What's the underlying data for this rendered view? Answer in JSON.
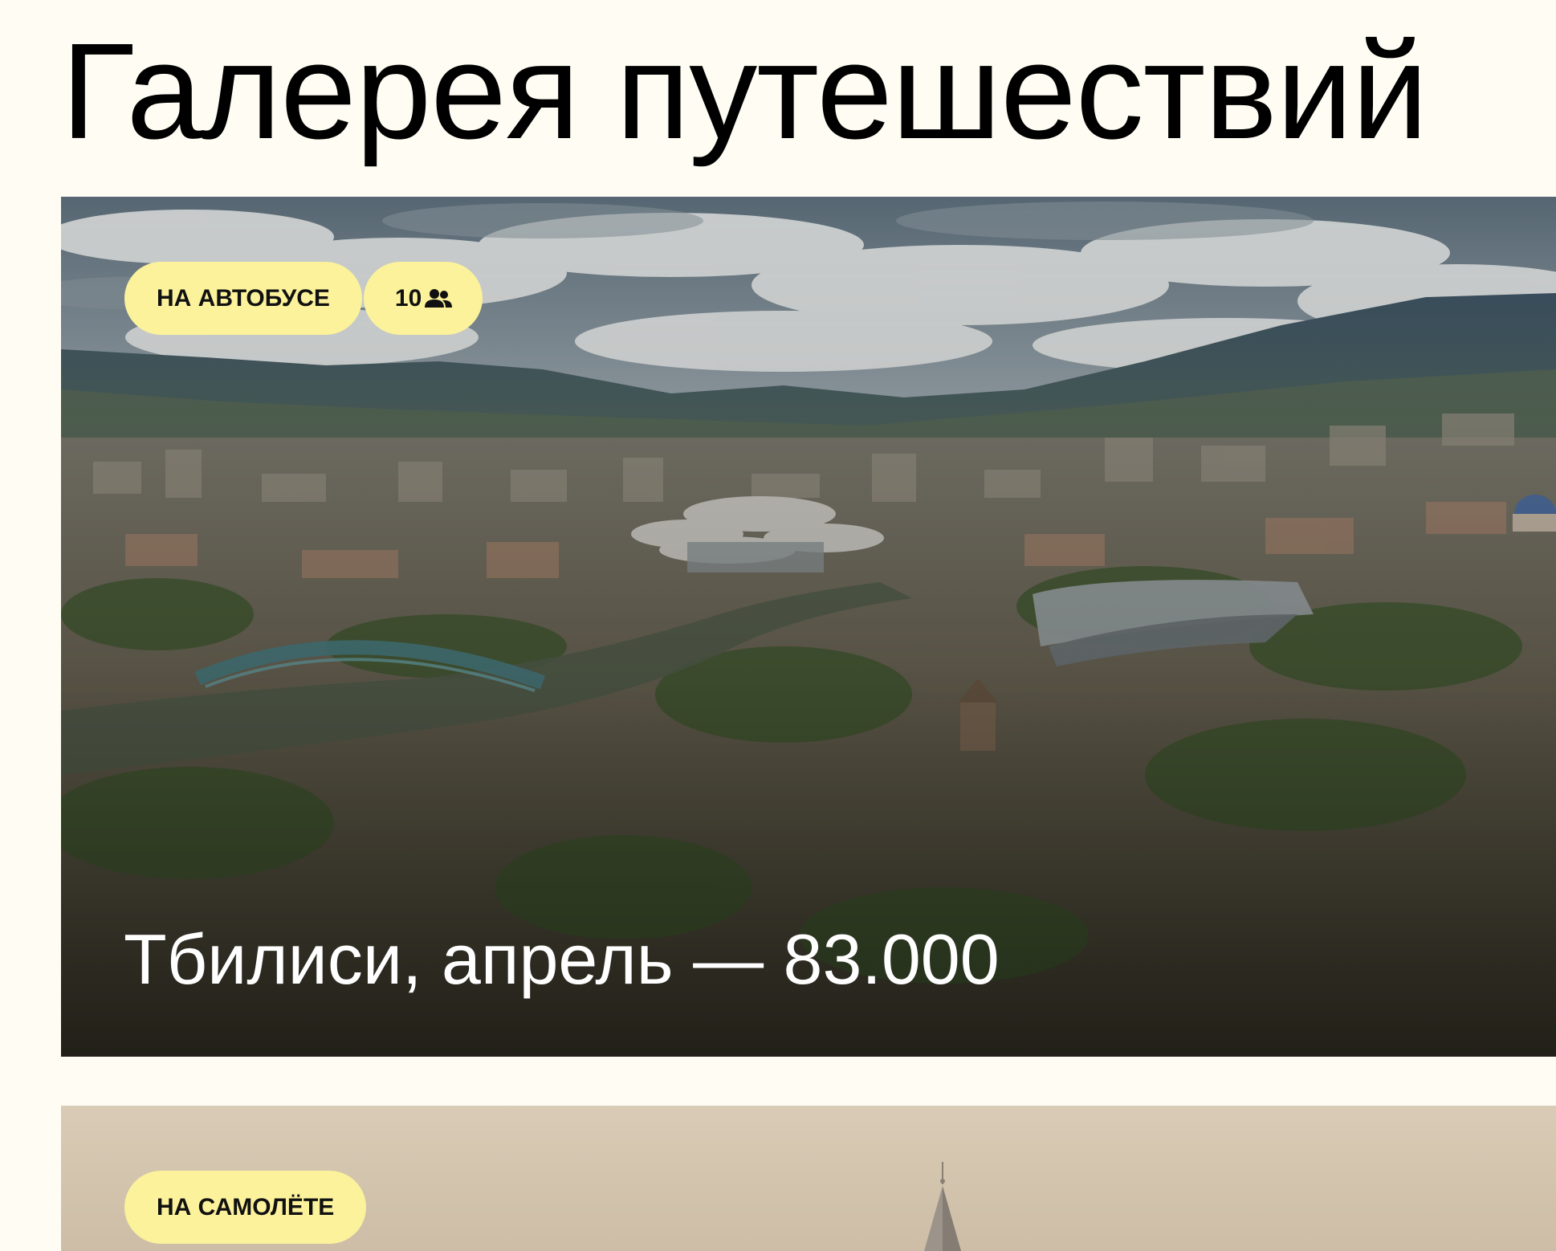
{
  "page": {
    "title": "Галерея путешествий"
  },
  "cards": [
    {
      "transport": "НА АВТОБУСЕ",
      "people_count": "10",
      "people_icon": "people-icon",
      "caption": "Тбилиси, апрель — 83.000"
    },
    {
      "transport": "НА САМОЛЁТЕ"
    }
  ],
  "colors": {
    "page_background": "#fffdf3",
    "badge_background": "#fcf29b",
    "badge_text": "#111111",
    "caption_text": "#ffffff"
  }
}
